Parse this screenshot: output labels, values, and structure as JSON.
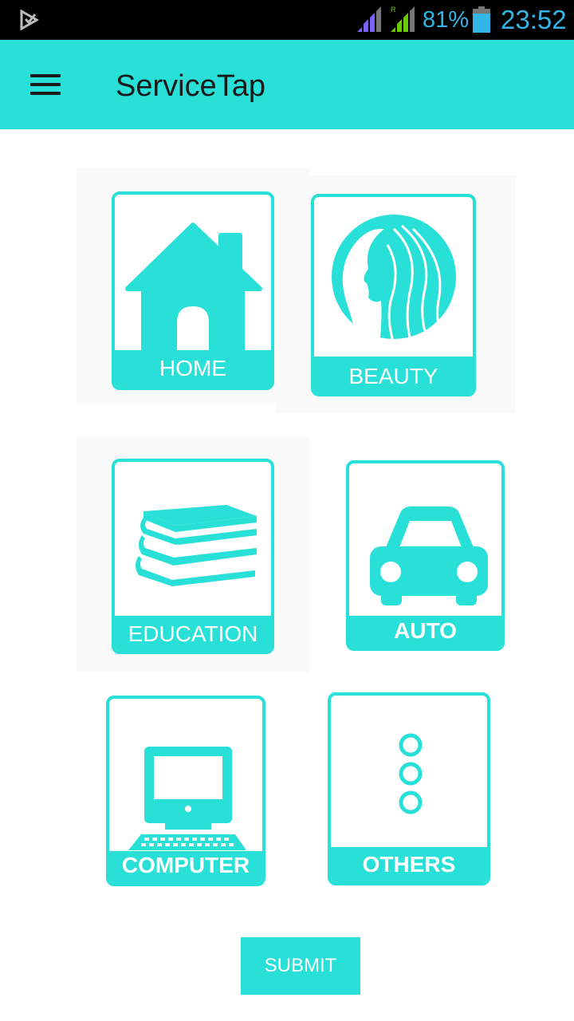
{
  "status_bar": {
    "battery_percent": "81%",
    "time": "23:52",
    "icons": [
      "play-store-notification-icon",
      "signal-strength-icon",
      "roaming-signal-icon",
      "battery-icon"
    ],
    "accent_color": "#33b5e5",
    "roaming_indicator": "R"
  },
  "app_bar": {
    "title": "ServiceTap",
    "menu_icon": "hamburger-menu-icon",
    "background_color": "#28e0d8"
  },
  "categories": [
    {
      "label": "HOME",
      "icon": "house-icon"
    },
    {
      "label": "BEAUTY",
      "icon": "woman-profile-icon"
    },
    {
      "label": "EDUCATION",
      "icon": "books-stack-icon"
    },
    {
      "label": "AUTO",
      "icon": "car-icon"
    },
    {
      "label": "COMPUTER",
      "icon": "desktop-computer-icon"
    },
    {
      "label": "OTHERS",
      "icon": "more-dots-icon"
    }
  ],
  "submit": {
    "label": "SUBMIT"
  },
  "theme": {
    "primary": "#28e0d8",
    "on_primary": "#ffffff"
  }
}
